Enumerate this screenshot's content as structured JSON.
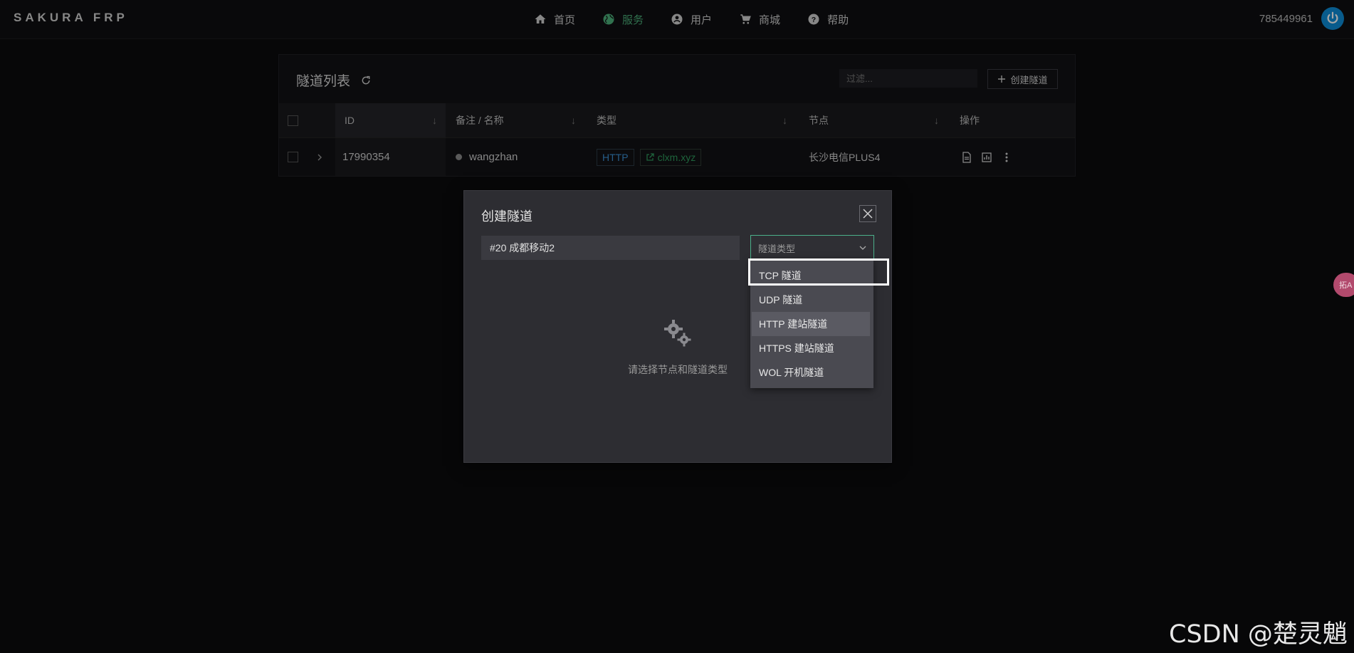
{
  "brand": "SAKURA FRP",
  "nav": [
    {
      "label": "首页",
      "icon": "home-icon",
      "active": false
    },
    {
      "label": "服务",
      "icon": "globe-icon",
      "active": true
    },
    {
      "label": "用户",
      "icon": "user-icon",
      "active": false
    },
    {
      "label": "商城",
      "icon": "cart-icon",
      "active": false
    },
    {
      "label": "帮助",
      "icon": "help-icon",
      "active": false
    }
  ],
  "user": {
    "id": "785449961",
    "icon": "power-icon",
    "icon_color": "#0d8dd8"
  },
  "panel": {
    "title": "隧道列表",
    "filter_placeholder": "过滤...",
    "create_label": "创建隧道",
    "columns": {
      "id": "ID",
      "name": "备注 / 名称",
      "type": "类型",
      "node": "节点",
      "ops": "操作"
    },
    "rows": [
      {
        "id": "17990354",
        "name": "wangzhan",
        "type": "HTTP",
        "domain": "clxm.xyz",
        "node": "长沙电信PLUS4"
      }
    ]
  },
  "dialog": {
    "title": "创建隧道",
    "node_value": "#20 成都移动2",
    "type_placeholder": "隧道类型",
    "empty_text": "请选择节点和隧道类型",
    "options": [
      "TCP 隧道",
      "UDP 隧道",
      "HTTP 建站隧道",
      "HTTPS 建站隧道",
      "WOL 开机隧道"
    ],
    "highlighted_option": "HTTP 建站隧道"
  },
  "translate_pill": "拓A",
  "watermark": "CSDN @楚灵魈",
  "colors": {
    "accent_green": "#4caf7a",
    "http_blue": "#3b8fd2",
    "focus_border": "#4bb08a"
  }
}
